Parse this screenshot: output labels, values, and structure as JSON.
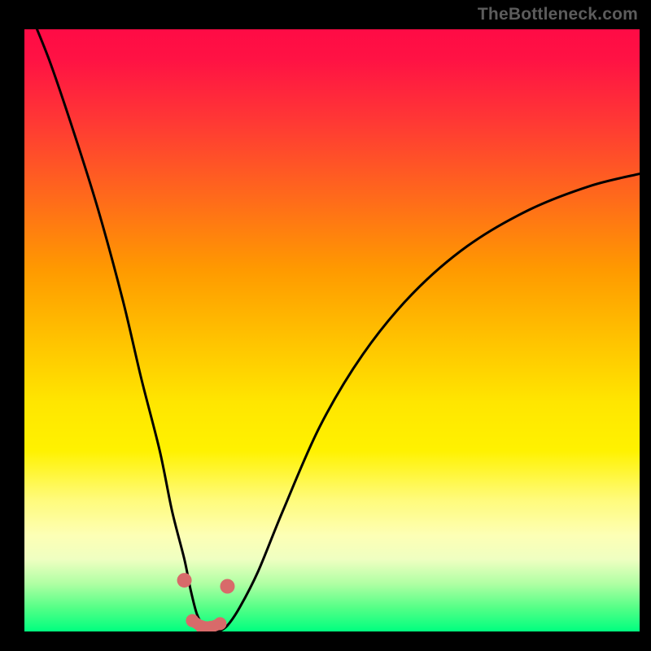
{
  "watermark": "TheBottleneck.com",
  "chart_data": {
    "type": "line",
    "title": "",
    "xlabel": "",
    "ylabel": "",
    "xlim": [
      0,
      100
    ],
    "ylim": [
      0,
      100
    ],
    "grid": false,
    "series": [
      {
        "name": "bottleneck-curve",
        "x": [
          0,
          4,
          8,
          12,
          16,
          19,
          22,
          24,
          26,
          27,
          28,
          29,
          30,
          31.5,
          33,
          35,
          38,
          42,
          48,
          55,
          63,
          72,
          82,
          92,
          100
        ],
        "values": [
          105,
          95,
          83,
          70,
          55,
          42,
          30,
          20,
          12,
          7,
          3,
          1,
          0,
          0,
          1,
          4,
          10,
          20,
          34,
          46,
          56,
          64,
          70,
          74,
          76
        ]
      }
    ],
    "markers": [
      {
        "name": "dot-left",
        "x": 26.0,
        "y": 8.5
      },
      {
        "name": "dot-right",
        "x": 33.0,
        "y": 7.5
      },
      {
        "name": "dot-bot-a",
        "x": 27.3,
        "y": 1.8
      },
      {
        "name": "dot-bot-b",
        "x": 28.8,
        "y": 0.8
      },
      {
        "name": "dot-bot-c",
        "x": 30.3,
        "y": 0.7
      },
      {
        "name": "dot-bot-d",
        "x": 31.8,
        "y": 1.3
      }
    ],
    "colors": {
      "curve": "#000000",
      "markers": "#d86a6a",
      "gradient_top": "#ff0b45",
      "gradient_bottom": "#00ff7f"
    }
  }
}
